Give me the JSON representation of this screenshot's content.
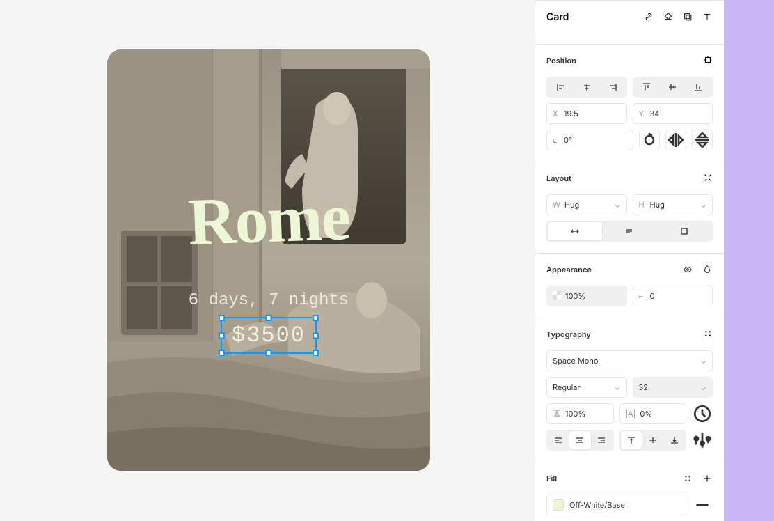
{
  "header": {
    "title": "Card"
  },
  "canvas": {
    "title": "Rome",
    "subtitle": "6 days, 7 nights",
    "price": "$3500"
  },
  "position": {
    "label": "Position",
    "x_prefix": "X",
    "x": "19.5",
    "y_prefix": "Y",
    "y": "34",
    "rotation": "0°"
  },
  "layout": {
    "label": "Layout",
    "w_prefix": "W",
    "w": "Hug",
    "h_prefix": "H",
    "h": "Hug"
  },
  "appearance": {
    "label": "Appearance",
    "opacity": "100%",
    "radius": "0"
  },
  "typography": {
    "label": "Typography",
    "font": "Space Mono",
    "weight": "Regular",
    "size": "32",
    "line_height": "100%",
    "letter_spacing": "0%"
  },
  "fill": {
    "label": "Fill",
    "color_name": "Off-White/Base",
    "color_hex": "#edf7d6"
  }
}
